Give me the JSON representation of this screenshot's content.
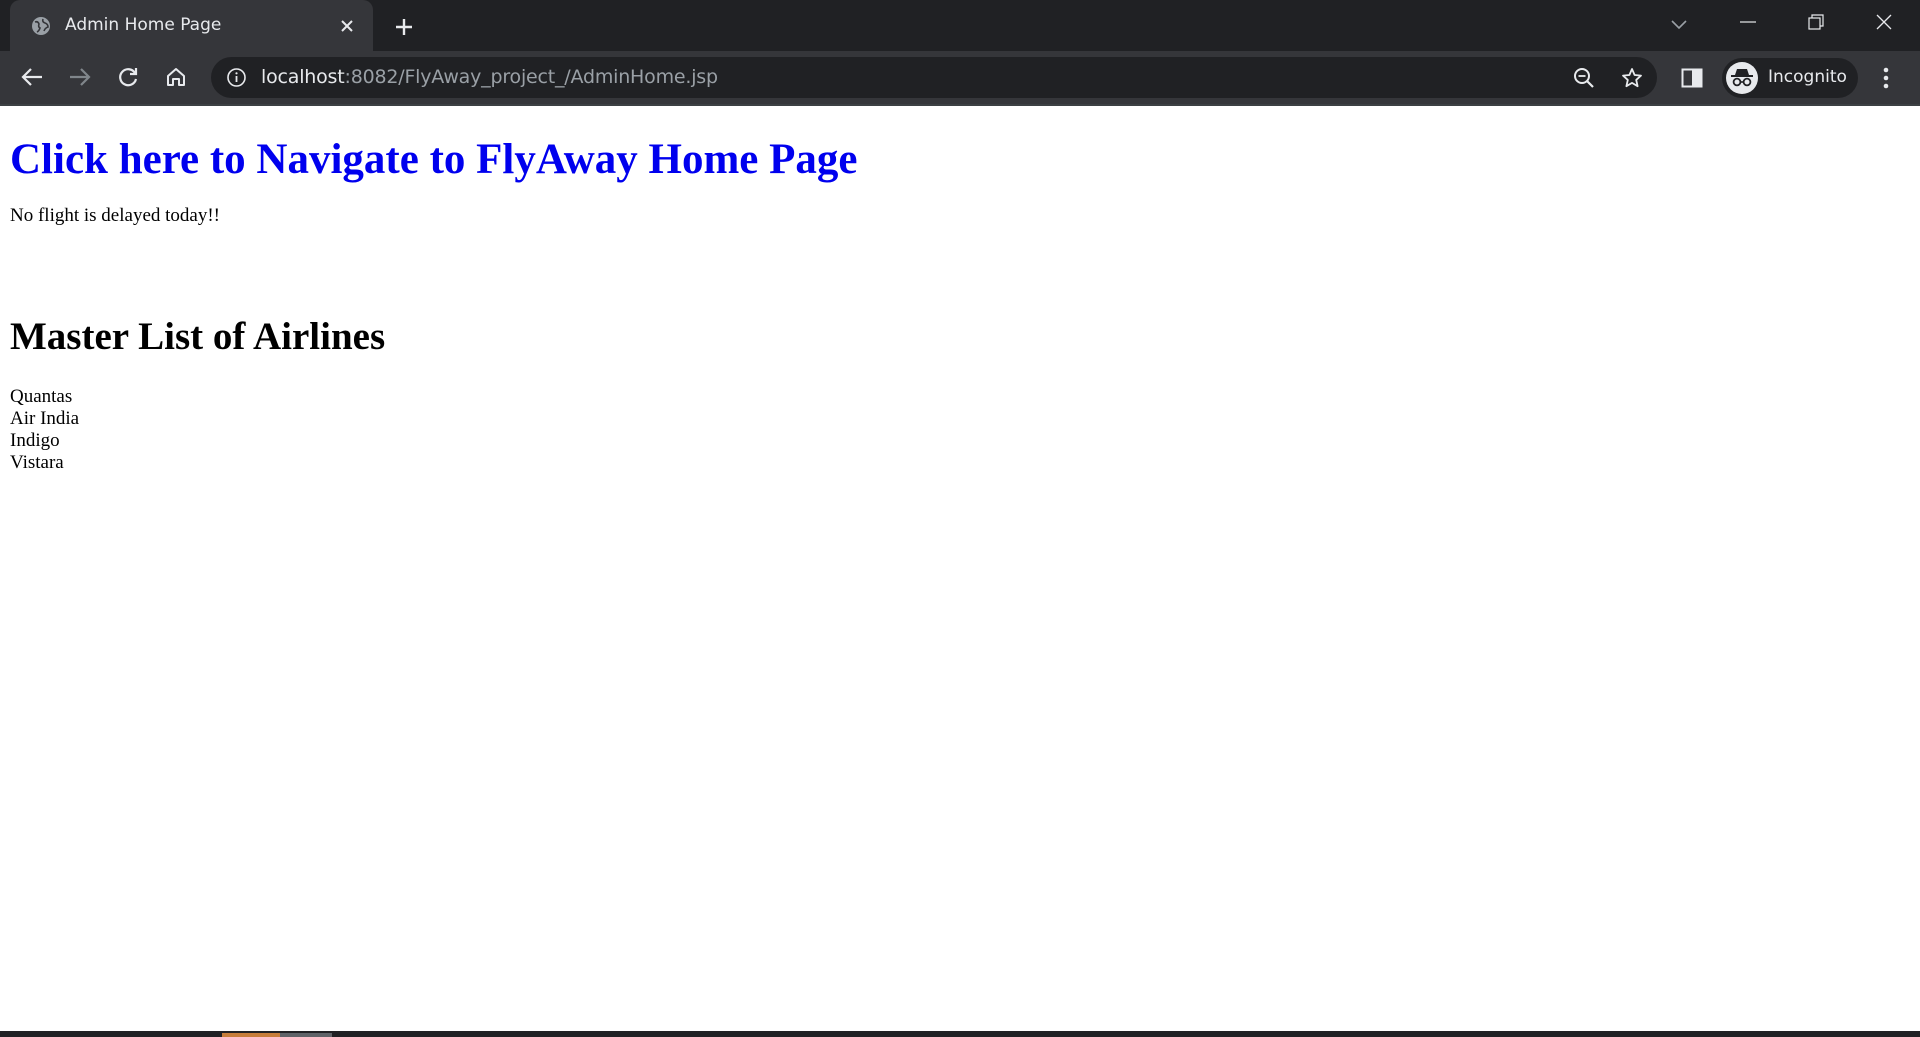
{
  "browser": {
    "tab": {
      "title": "Admin Home Page",
      "favicon": "globe-icon"
    },
    "address_bar": {
      "host": "localhost",
      "path": ":8082/FlyAway_project_/AdminHome.jsp"
    },
    "profile": {
      "label": "Incognito"
    }
  },
  "page": {
    "home_link_text": "Click here to Navigate to FlyAway Home Page",
    "delay_message": "No flight is delayed today!!",
    "airlines_heading": "Master List of Airlines",
    "airlines": [
      "Quantas",
      "Air India",
      "Indigo",
      "Vistara"
    ]
  },
  "colors": {
    "link": "#0000ee",
    "chrome_dark": "#202124",
    "chrome_tab": "#35363a",
    "chrome_text": "#e8eaed"
  }
}
